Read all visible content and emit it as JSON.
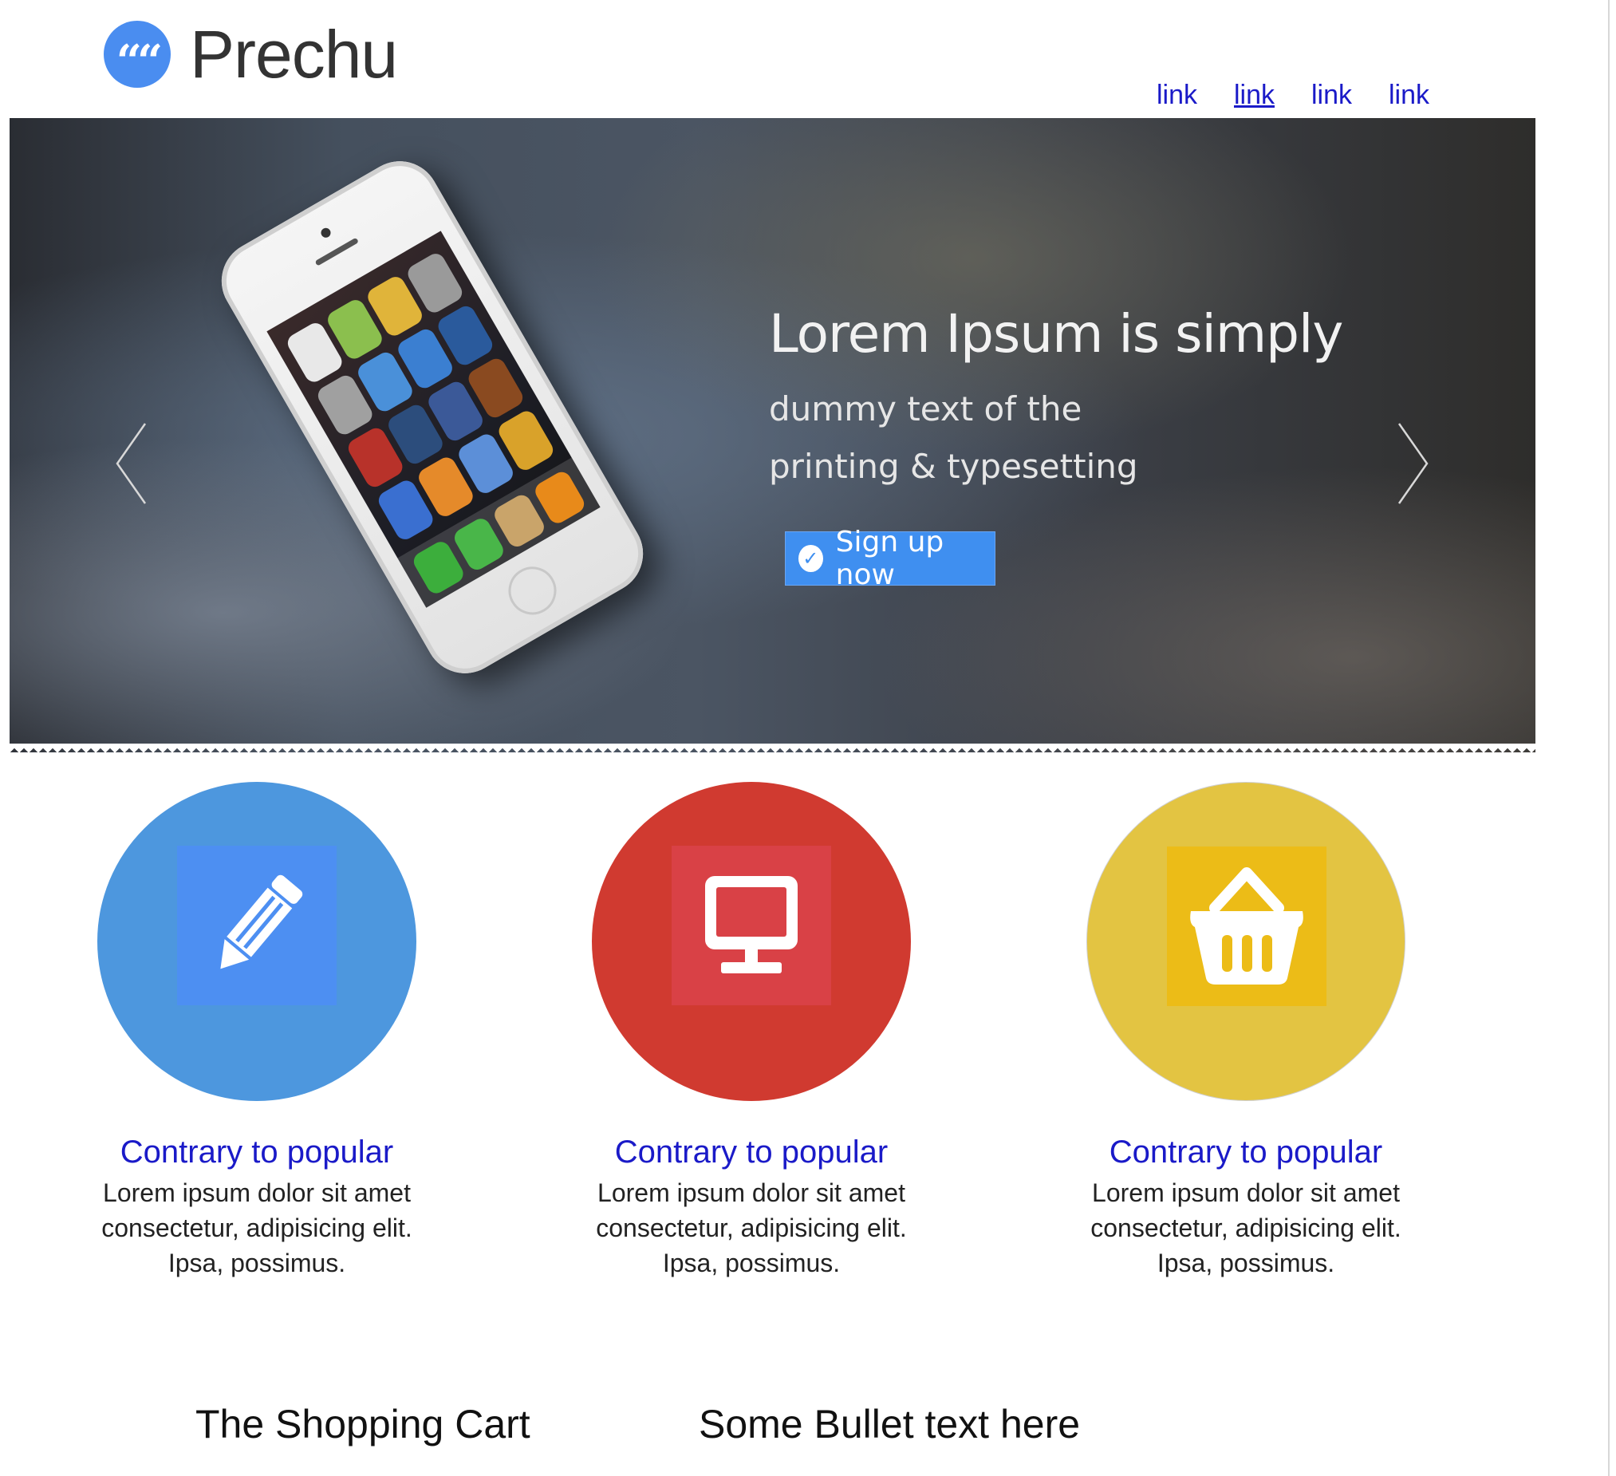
{
  "header": {
    "logo_text": "Prechu",
    "logo_mark": "“",
    "nav_links": [
      "link",
      "link",
      "link",
      "link"
    ]
  },
  "hero": {
    "title": "Lorem Ipsum is simply",
    "subtitle_line1": "dummy text of the",
    "subtitle_line2": "printing & typesetting",
    "cta_label": "Sign up now",
    "cta_icon": "check-circle-icon",
    "prev_icon": "chevron-left-icon",
    "next_icon": "chevron-right-icon"
  },
  "features": [
    {
      "icon": "pencil-icon",
      "circle_color": "#4d97de",
      "square_color": "#4d8ff2",
      "title": "Contrary to popular",
      "text": "Lorem ipsum dolor sit amet consectetur, adipisicing elit. Ipsa, possimus."
    },
    {
      "icon": "monitor-icon",
      "circle_color": "#d03a30",
      "square_color": "#d94146",
      "title": "Contrary to popular",
      "text": "Lorem ipsum dolor sit amet consectetur, adipisicing elit. Ipsa, possimus."
    },
    {
      "icon": "basket-icon",
      "circle_color": "#e3c442",
      "square_color": "#ecbc17",
      "title": "Contrary to popular",
      "text": "Lorem ipsum dolor sit amet consectetur, adipisicing elit. Ipsa, possimus."
    }
  ],
  "bottom": {
    "heading_left": "The Shopping Cart",
    "heading_right": "Some Bullet text here"
  },
  "colors": {
    "link": "#1a1ac8",
    "accent": "#3f8ff0"
  }
}
